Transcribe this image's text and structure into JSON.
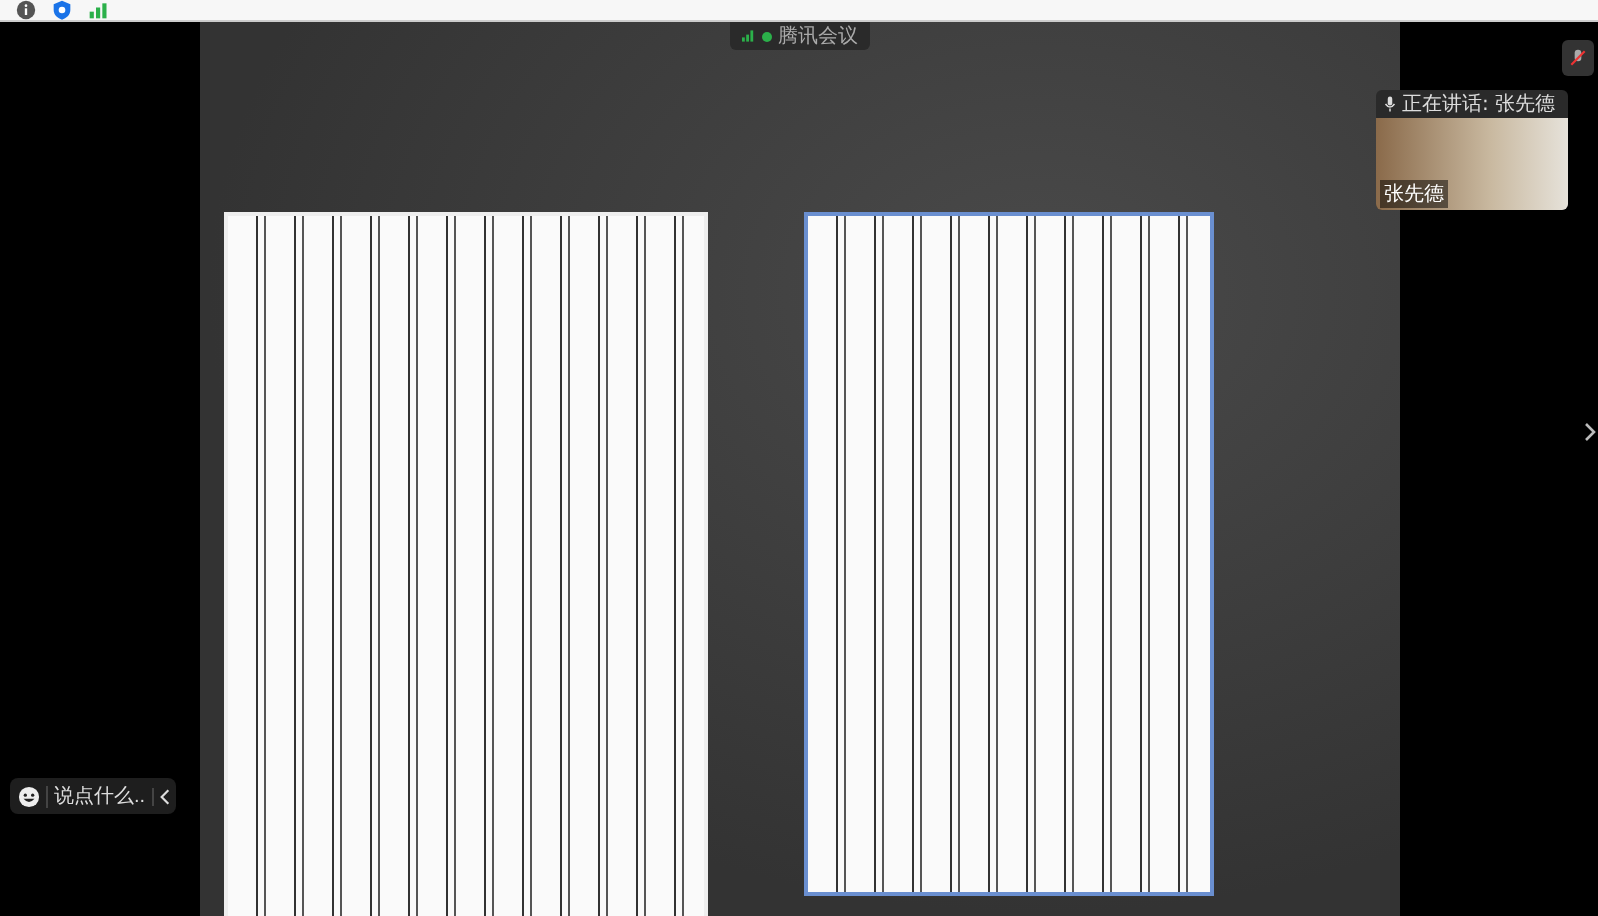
{
  "meeting": {
    "title": "腾讯会议"
  },
  "speaker": {
    "speaking_label": "正在讲话: 张先德",
    "name_tag": "张先德"
  },
  "chat": {
    "placeholder": "说点什么..."
  }
}
